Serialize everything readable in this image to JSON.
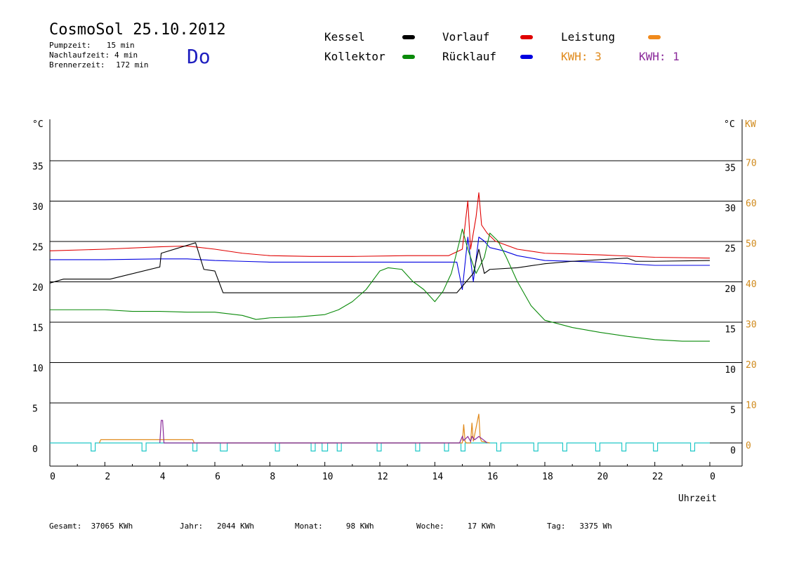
{
  "header": {
    "title": "CosmoSol 25.10.2012",
    "day": "Do",
    "info": [
      {
        "label": "Pumpzeit:",
        "value": "15 min"
      },
      {
        "label": "Nachlaufzeit:",
        "value": "4 min"
      },
      {
        "label": "Brennerzeit:",
        "value": "172 min"
      }
    ]
  },
  "legend": {
    "kessel": {
      "label": "Kessel",
      "color": "#000000"
    },
    "vorlauf": {
      "label": "Vorlauf",
      "color": "#e00000"
    },
    "leistung": {
      "label": "Leistung",
      "color": "#f08a1c"
    },
    "kollektor": {
      "label": "Kollektor",
      "color": "#0a8a0a"
    },
    "ruecklauf": {
      "label": "Rücklauf",
      "color": "#0000e0"
    },
    "kwh_orange": {
      "label": "KWH: 3",
      "color": "#e08a1c"
    },
    "kwh_purple": {
      "label": "KWH: 1",
      "color": "#8a2a9a"
    }
  },
  "footer": [
    {
      "label": "Gesamt:",
      "value": "37065 KWh"
    },
    {
      "label": "Jahr:",
      "value": "2044 KWh"
    },
    {
      "label": "Monat:",
      "value": "98 KWh"
    },
    {
      "label": "Woche:",
      "value": "17 KWh"
    },
    {
      "label": "Tag:",
      "value": "3375 Wh"
    }
  ],
  "chart_data": {
    "type": "line",
    "xlabel": "Uhrzeit",
    "ylabel_left": "°C",
    "ylabel_right": "°C",
    "ylabel_right2": "KW",
    "xlim": [
      0,
      24
    ],
    "ylim": [
      0,
      40
    ],
    "y2lim": [
      0,
      80
    ],
    "x_ticks": [
      "0",
      "2",
      "4",
      "6",
      "8",
      "10",
      "12",
      "14",
      "16",
      "18",
      "20",
      "22",
      "0"
    ],
    "y_ticks": [
      "0",
      "5",
      "10",
      "15",
      "20",
      "25",
      "30",
      "35"
    ],
    "y2_ticks": [
      "0",
      "10",
      "20",
      "30",
      "40",
      "50",
      "60",
      "70"
    ],
    "grid": true,
    "series": [
      {
        "name": "Vorlauf",
        "color": "#e00000",
        "x": [
          0,
          2,
          4,
          5,
          6,
          7,
          8,
          9.5,
          11,
          13,
          14.5,
          15,
          15.2,
          15.3,
          15.5,
          15.6,
          15.7,
          15.9,
          16.2,
          17,
          18,
          20,
          22,
          24
        ],
        "y": [
          23.8,
          24.0,
          24.3,
          24.4,
          24.0,
          23.5,
          23.2,
          23.1,
          23.1,
          23.2,
          23.2,
          24,
          30,
          24,
          28,
          31,
          27,
          26,
          25,
          24,
          23.5,
          23.3,
          23.0,
          22.9
        ]
      },
      {
        "name": "Rücklauf",
        "color": "#0000e0",
        "x": [
          0,
          2,
          4,
          5,
          6,
          7,
          8,
          10,
          12,
          14,
          14.8,
          15,
          15.2,
          15.4,
          15.6,
          15.8,
          16,
          16.5,
          17,
          18,
          20,
          22,
          24
        ],
        "y": [
          22.7,
          22.7,
          22.8,
          22.8,
          22.6,
          22.5,
          22.4,
          22.4,
          22.4,
          22.4,
          22.4,
          19,
          25.5,
          20,
          25.5,
          25,
          24.2,
          23.8,
          23.2,
          22.6,
          22.4,
          22.0,
          22.0
        ]
      },
      {
        "name": "Kessel",
        "color": "#000000",
        "x": [
          0,
          0.5,
          2.2,
          4,
          4.05,
          5.3,
          5.6,
          6.0,
          6.2,
          6.3,
          8,
          10,
          12,
          14,
          14.8,
          15,
          15.4,
          15.6,
          15.8,
          16,
          17,
          18,
          19,
          20,
          21,
          21.3,
          22,
          24
        ],
        "y": [
          19.8,
          20.3,
          20.3,
          21.8,
          23.5,
          24.8,
          21.5,
          21.3,
          19.5,
          18.6,
          18.6,
          18.6,
          18.6,
          18.6,
          18.6,
          19.4,
          21,
          24,
          21,
          21.5,
          21.7,
          22.2,
          22.5,
          22.7,
          22.9,
          22.5,
          22.5,
          22.6
        ]
      },
      {
        "name": "Kollektor",
        "color": "#0a8a0a",
        "x": [
          0,
          1,
          2,
          3,
          4,
          5,
          6,
          7,
          7.5,
          8,
          9,
          10,
          10.5,
          11,
          11.5,
          12,
          12.3,
          12.8,
          13.2,
          13.6,
          14,
          14.3,
          14.6,
          14.9,
          15,
          15.2,
          15.5,
          15.8,
          16,
          16.3,
          16.6,
          17,
          17.5,
          18,
          19,
          20,
          21,
          22,
          23,
          24
        ],
        "y": [
          16.5,
          16.5,
          16.5,
          16.3,
          16.3,
          16.2,
          16.2,
          15.8,
          15.3,
          15.5,
          15.6,
          15.9,
          16.5,
          17.5,
          19,
          21.3,
          21.7,
          21.5,
          20,
          19,
          17.5,
          18.8,
          21,
          25,
          26.5,
          24,
          21,
          23,
          26,
          25,
          23,
          20,
          17,
          15.2,
          14.3,
          13.7,
          13.2,
          12.8,
          12.6,
          12.6
        ]
      }
    ],
    "power_series": [
      {
        "name": "KWH: 3",
        "color": "#e08a1c",
        "x": [
          1.8,
          1.85,
          5.2,
          5.25,
          15.0,
          15.05,
          15.1,
          15.15,
          15.3,
          15.35,
          15.4,
          15.6,
          15.65,
          15.7,
          16.0
        ],
        "y": [
          0,
          0.4,
          0.4,
          0,
          0,
          2.3,
          0.2,
          0,
          0,
          2.5,
          0.2,
          3.6,
          0.6,
          0.2,
          0
        ]
      },
      {
        "name": "KWH: 1",
        "color": "#8a2a9a",
        "x": [
          4.0,
          4.05,
          4.1,
          4.15,
          14.9,
          15.0,
          15.05,
          15.2,
          15.3,
          15.35,
          15.45,
          15.6,
          15.8,
          15.9
        ],
        "y": [
          0,
          2.8,
          2.8,
          0,
          0,
          0.8,
          0.3,
          0.8,
          0.2,
          0.8,
          0.4,
          0.8,
          0.3,
          0
        ]
      }
    ],
    "pump_pulses": {
      "color": "#20c8c8",
      "starts": [
        1.5,
        3.35,
        5.2,
        6.2,
        8.2,
        9.5,
        9.9,
        10.45,
        11.9,
        13.3,
        14.35,
        14.95,
        16.25,
        17.6,
        18.65,
        19.85,
        20.8,
        21.95,
        23.3
      ],
      "ends": [
        1.65,
        3.5,
        5.35,
        6.45,
        8.35,
        9.65,
        10.1,
        10.6,
        12.05,
        13.45,
        14.5,
        15.1,
        16.4,
        17.75,
        18.8,
        20.0,
        20.95,
        22.1,
        23.45
      ],
      "depth": 1.0
    }
  }
}
